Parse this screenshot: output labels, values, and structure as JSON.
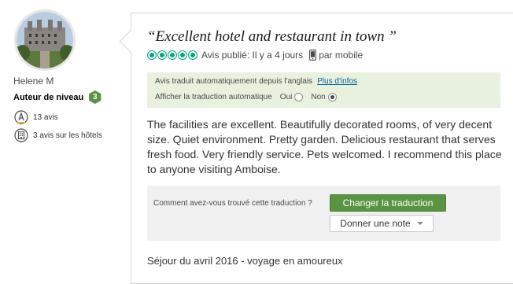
{
  "reviewer": {
    "name": "Helene M",
    "level_label": "Auteur de niveau",
    "level": "3",
    "reviews_count": "13 avis",
    "hotel_reviews_count": "3 avis sur les hôtels"
  },
  "review": {
    "title": "“Excellent hotel and restaurant in town ”",
    "rating": 5,
    "published": "Avis publié: Il y a 4 jours",
    "via": "par mobile",
    "text": "The facilities are excellent. Beautifully decorated rooms, of very decent size. Quiet environment. Pretty garden. Delicious restaurant that serves fresh food. Very friendly service. Pets welcomed. I recommend this place to anyone visiting Amboise.",
    "stay": "Séjour du avril 2016 - voyage en amoureux"
  },
  "translation": {
    "notice": "Avis traduit automatiquement depuis l'anglais",
    "more_info": "Plus d'infos",
    "auto_label": "Afficher la traduction automatique",
    "yes_label": "Oui",
    "no_label": "Non",
    "selected": "Non"
  },
  "feedback": {
    "question": "Comment avez-vous trouvé cette traduction ?",
    "change_button": "Changer la traduction",
    "rate_button": "Donner une note"
  },
  "colors": {
    "bubble": "#00a680",
    "level_badge": "#589442",
    "button_green": "#589442",
    "notice_bg": "#e8f0de",
    "link": "#006699"
  }
}
